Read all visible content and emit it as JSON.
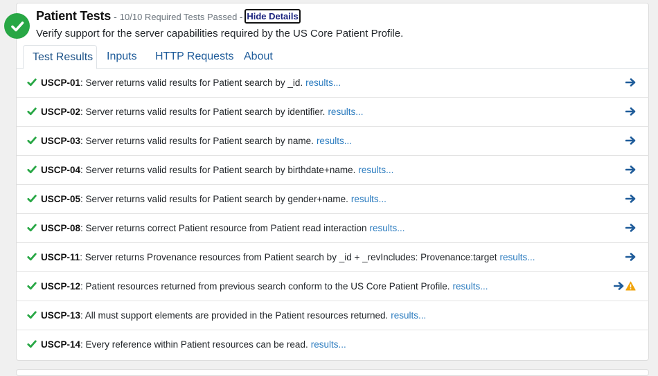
{
  "header": {
    "title": "Patient Tests",
    "separator": "-",
    "summary": "10/10 Required Tests Passed -",
    "hide_details_label": "Hide Details",
    "description": "Verify support for the server capabilities required by the US Core Patient Profile."
  },
  "tabs": [
    {
      "label": "Test Results",
      "active": true
    },
    {
      "label": "Inputs",
      "active": false
    },
    {
      "label": "HTTP Requests",
      "active": false
    },
    {
      "label": "About",
      "active": false
    }
  ],
  "colors": {
    "pass_green": "#28a745",
    "link_blue": "#2a7bbf",
    "arrow_blue": "#1f5c9a",
    "warning_orange": "#f0a30a"
  },
  "results_link_text": "results...",
  "tests": [
    {
      "id": "USCP-01",
      "desc": ": Server returns valid results for Patient search by _id.",
      "status": "pass",
      "icons": [
        "arrow-right-icon"
      ]
    },
    {
      "id": "USCP-02",
      "desc": ": Server returns valid results for Patient search by identifier.",
      "status": "pass",
      "icons": [
        "arrow-right-icon"
      ]
    },
    {
      "id": "USCP-03",
      "desc": ": Server returns valid results for Patient search by name.",
      "status": "pass",
      "icons": [
        "arrow-right-icon"
      ]
    },
    {
      "id": "USCP-04",
      "desc": ": Server returns valid results for Patient search by birthdate+name.",
      "status": "pass",
      "icons": [
        "arrow-right-icon"
      ]
    },
    {
      "id": "USCP-05",
      "desc": ": Server returns valid results for Patient search by gender+name.",
      "status": "pass",
      "icons": [
        "arrow-right-icon"
      ]
    },
    {
      "id": "USCP-08",
      "desc": ": Server returns correct Patient resource from Patient read interaction",
      "status": "pass",
      "icons": [
        "arrow-right-icon"
      ]
    },
    {
      "id": "USCP-11",
      "desc": ": Server returns Provenance resources from Patient search by _id + _revIncludes: Provenance:target",
      "status": "pass",
      "icons": [
        "arrow-right-icon"
      ]
    },
    {
      "id": "USCP-12",
      "desc": ": Patient resources returned from previous search conform to the US Core Patient Profile.",
      "status": "pass",
      "icons": [
        "arrow-right-icon",
        "warning-icon"
      ]
    },
    {
      "id": "USCP-13",
      "desc": ": All must support elements are provided in the Patient resources returned.",
      "status": "pass",
      "icons": []
    },
    {
      "id": "USCP-14",
      "desc": ": Every reference within Patient resources can be read.",
      "status": "pass",
      "icons": []
    }
  ]
}
